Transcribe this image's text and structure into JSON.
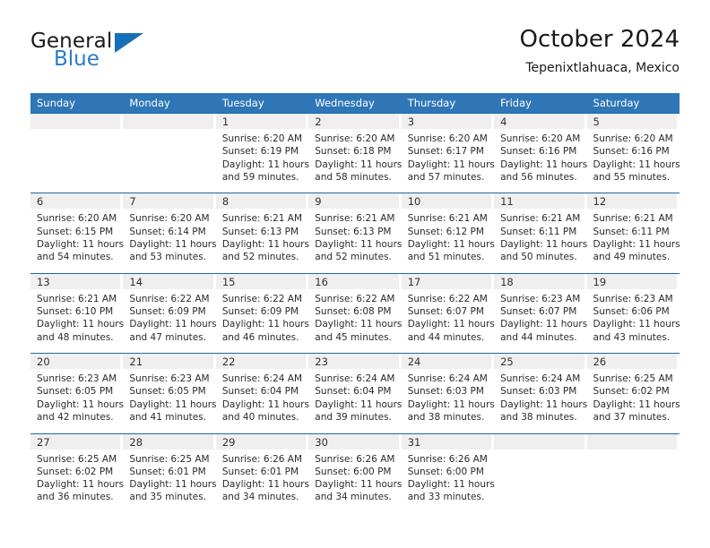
{
  "logo": {
    "word_dark": "General",
    "word_blue": "Blue",
    "triangle_color": "#1470b8",
    "blue_color": "#2b7cc4"
  },
  "header": {
    "title": "October 2024",
    "subtitle": "Tepenixtlahuaca, Mexico"
  },
  "theme": {
    "header_blue": "#2f76b6",
    "separator_blue": "#1d68ab",
    "day_band_gray": "#efefef",
    "text_color": "#2b2b2b"
  },
  "calendar": {
    "weekdays": [
      "Sunday",
      "Monday",
      "Tuesday",
      "Wednesday",
      "Thursday",
      "Friday",
      "Saturday"
    ],
    "weeks": [
      [
        {
          "day": "",
          "lines": []
        },
        {
          "day": "",
          "lines": []
        },
        {
          "day": "1",
          "lines": [
            "Sunrise: 6:20 AM",
            "Sunset: 6:19 PM",
            "Daylight: 11 hours",
            "and 59 minutes."
          ]
        },
        {
          "day": "2",
          "lines": [
            "Sunrise: 6:20 AM",
            "Sunset: 6:18 PM",
            "Daylight: 11 hours",
            "and 58 minutes."
          ]
        },
        {
          "day": "3",
          "lines": [
            "Sunrise: 6:20 AM",
            "Sunset: 6:17 PM",
            "Daylight: 11 hours",
            "and 57 minutes."
          ]
        },
        {
          "day": "4",
          "lines": [
            "Sunrise: 6:20 AM",
            "Sunset: 6:16 PM",
            "Daylight: 11 hours",
            "and 56 minutes."
          ]
        },
        {
          "day": "5",
          "lines": [
            "Sunrise: 6:20 AM",
            "Sunset: 6:16 PM",
            "Daylight: 11 hours",
            "and 55 minutes."
          ]
        }
      ],
      [
        {
          "day": "6",
          "lines": [
            "Sunrise: 6:20 AM",
            "Sunset: 6:15 PM",
            "Daylight: 11 hours",
            "and 54 minutes."
          ]
        },
        {
          "day": "7",
          "lines": [
            "Sunrise: 6:20 AM",
            "Sunset: 6:14 PM",
            "Daylight: 11 hours",
            "and 53 minutes."
          ]
        },
        {
          "day": "8",
          "lines": [
            "Sunrise: 6:21 AM",
            "Sunset: 6:13 PM",
            "Daylight: 11 hours",
            "and 52 minutes."
          ]
        },
        {
          "day": "9",
          "lines": [
            "Sunrise: 6:21 AM",
            "Sunset: 6:13 PM",
            "Daylight: 11 hours",
            "and 52 minutes."
          ]
        },
        {
          "day": "10",
          "lines": [
            "Sunrise: 6:21 AM",
            "Sunset: 6:12 PM",
            "Daylight: 11 hours",
            "and 51 minutes."
          ]
        },
        {
          "day": "11",
          "lines": [
            "Sunrise: 6:21 AM",
            "Sunset: 6:11 PM",
            "Daylight: 11 hours",
            "and 50 minutes."
          ]
        },
        {
          "day": "12",
          "lines": [
            "Sunrise: 6:21 AM",
            "Sunset: 6:11 PM",
            "Daylight: 11 hours",
            "and 49 minutes."
          ]
        }
      ],
      [
        {
          "day": "13",
          "lines": [
            "Sunrise: 6:21 AM",
            "Sunset: 6:10 PM",
            "Daylight: 11 hours",
            "and 48 minutes."
          ]
        },
        {
          "day": "14",
          "lines": [
            "Sunrise: 6:22 AM",
            "Sunset: 6:09 PM",
            "Daylight: 11 hours",
            "and 47 minutes."
          ]
        },
        {
          "day": "15",
          "lines": [
            "Sunrise: 6:22 AM",
            "Sunset: 6:09 PM",
            "Daylight: 11 hours",
            "and 46 minutes."
          ]
        },
        {
          "day": "16",
          "lines": [
            "Sunrise: 6:22 AM",
            "Sunset: 6:08 PM",
            "Daylight: 11 hours",
            "and 45 minutes."
          ]
        },
        {
          "day": "17",
          "lines": [
            "Sunrise: 6:22 AM",
            "Sunset: 6:07 PM",
            "Daylight: 11 hours",
            "and 44 minutes."
          ]
        },
        {
          "day": "18",
          "lines": [
            "Sunrise: 6:23 AM",
            "Sunset: 6:07 PM",
            "Daylight: 11 hours",
            "and 44 minutes."
          ]
        },
        {
          "day": "19",
          "lines": [
            "Sunrise: 6:23 AM",
            "Sunset: 6:06 PM",
            "Daylight: 11 hours",
            "and 43 minutes."
          ]
        }
      ],
      [
        {
          "day": "20",
          "lines": [
            "Sunrise: 6:23 AM",
            "Sunset: 6:05 PM",
            "Daylight: 11 hours",
            "and 42 minutes."
          ]
        },
        {
          "day": "21",
          "lines": [
            "Sunrise: 6:23 AM",
            "Sunset: 6:05 PM",
            "Daylight: 11 hours",
            "and 41 minutes."
          ]
        },
        {
          "day": "22",
          "lines": [
            "Sunrise: 6:24 AM",
            "Sunset: 6:04 PM",
            "Daylight: 11 hours",
            "and 40 minutes."
          ]
        },
        {
          "day": "23",
          "lines": [
            "Sunrise: 6:24 AM",
            "Sunset: 6:04 PM",
            "Daylight: 11 hours",
            "and 39 minutes."
          ]
        },
        {
          "day": "24",
          "lines": [
            "Sunrise: 6:24 AM",
            "Sunset: 6:03 PM",
            "Daylight: 11 hours",
            "and 38 minutes."
          ]
        },
        {
          "day": "25",
          "lines": [
            "Sunrise: 6:24 AM",
            "Sunset: 6:03 PM",
            "Daylight: 11 hours",
            "and 38 minutes."
          ]
        },
        {
          "day": "26",
          "lines": [
            "Sunrise: 6:25 AM",
            "Sunset: 6:02 PM",
            "Daylight: 11 hours",
            "and 37 minutes."
          ]
        }
      ],
      [
        {
          "day": "27",
          "lines": [
            "Sunrise: 6:25 AM",
            "Sunset: 6:02 PM",
            "Daylight: 11 hours",
            "and 36 minutes."
          ]
        },
        {
          "day": "28",
          "lines": [
            "Sunrise: 6:25 AM",
            "Sunset: 6:01 PM",
            "Daylight: 11 hours",
            "and 35 minutes."
          ]
        },
        {
          "day": "29",
          "lines": [
            "Sunrise: 6:26 AM",
            "Sunset: 6:01 PM",
            "Daylight: 11 hours",
            "and 34 minutes."
          ]
        },
        {
          "day": "30",
          "lines": [
            "Sunrise: 6:26 AM",
            "Sunset: 6:00 PM",
            "Daylight: 11 hours",
            "and 34 minutes."
          ]
        },
        {
          "day": "31",
          "lines": [
            "Sunrise: 6:26 AM",
            "Sunset: 6:00 PM",
            "Daylight: 11 hours",
            "and 33 minutes."
          ]
        },
        {
          "day": "",
          "lines": []
        },
        {
          "day": "",
          "lines": []
        }
      ]
    ]
  }
}
